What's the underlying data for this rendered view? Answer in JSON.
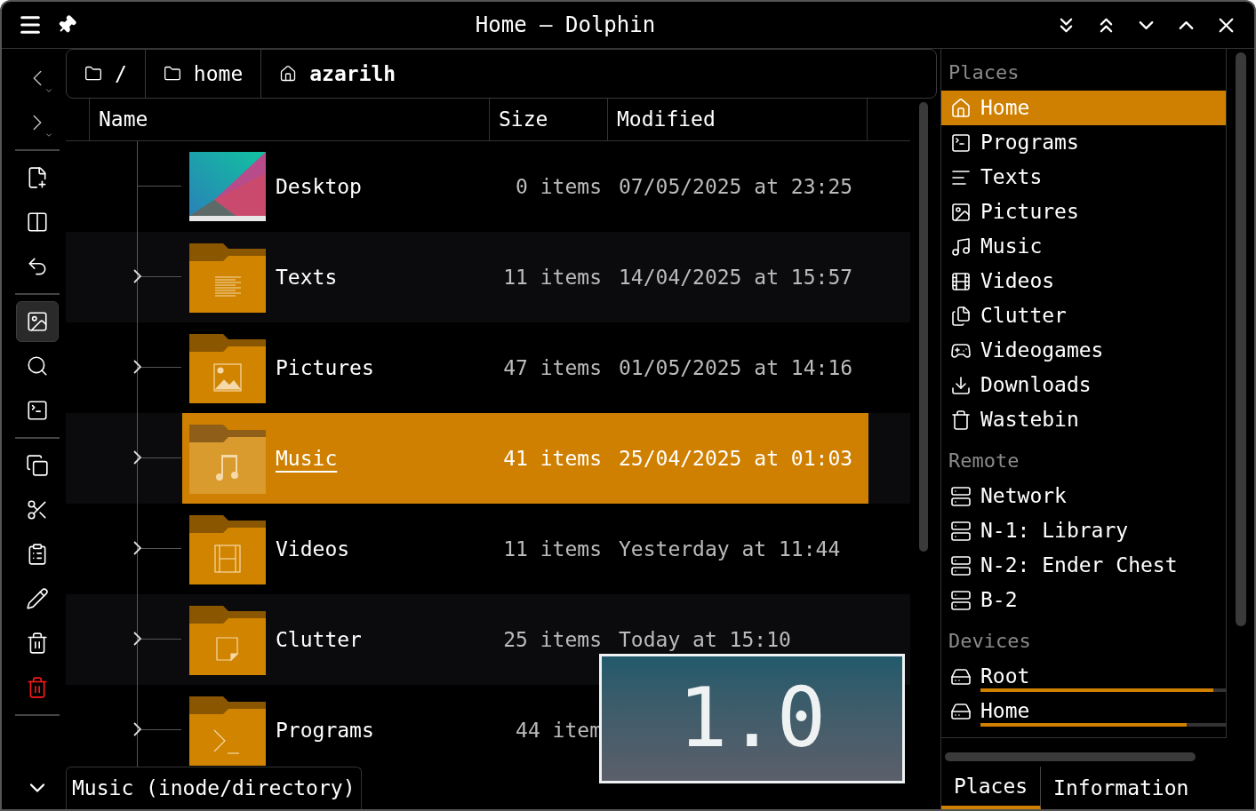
{
  "window": {
    "title": "Home — Dolphin"
  },
  "toolbar": [
    {
      "kind": "back",
      "selected": false
    },
    {
      "kind": "forward",
      "selected": false
    },
    {
      "kind": "separator"
    },
    {
      "kind": "new-file",
      "selected": false
    },
    {
      "kind": "split",
      "selected": false
    },
    {
      "kind": "undo",
      "selected": false
    },
    {
      "kind": "separator"
    },
    {
      "kind": "preview",
      "selected": true
    },
    {
      "kind": "search",
      "selected": false
    },
    {
      "kind": "terminal",
      "selected": false
    },
    {
      "kind": "separator"
    },
    {
      "kind": "copy",
      "selected": false
    },
    {
      "kind": "cut",
      "selected": false
    },
    {
      "kind": "paste",
      "selected": false
    },
    {
      "kind": "rename",
      "selected": false
    },
    {
      "kind": "trash",
      "selected": false
    },
    {
      "kind": "delete",
      "selected": false
    },
    {
      "kind": "separator"
    }
  ],
  "breadcrumb": [
    {
      "kind": "folder",
      "label": "/",
      "selected": false
    },
    {
      "kind": "folder",
      "label": "home",
      "selected": false
    },
    {
      "kind": "home",
      "label": "azarilh",
      "selected": true
    }
  ],
  "columns": [
    "Name",
    "Size",
    "Modified"
  ],
  "rows": [
    {
      "name": "Desktop",
      "kind": "wallpaper",
      "size": "0 items",
      "modified": "07/05/2025 at 23:25",
      "expandable": false,
      "selected": false
    },
    {
      "name": "Texts",
      "kind": "texts",
      "size": "11 items",
      "modified": "14/04/2025 at 15:57",
      "expandable": true,
      "selected": false
    },
    {
      "name": "Pictures",
      "kind": "pictures",
      "size": "47 items",
      "modified": "01/05/2025 at 14:16",
      "expandable": true,
      "selected": false
    },
    {
      "name": "Music",
      "kind": "music",
      "size": "41 items",
      "modified": "25/04/2025 at 01:03",
      "expandable": true,
      "selected": true
    },
    {
      "name": "Videos",
      "kind": "videos",
      "size": "11 items",
      "modified": "Yesterday at 11:44",
      "expandable": true,
      "selected": false
    },
    {
      "name": "Clutter",
      "kind": "clutter",
      "size": "25 items",
      "modified": "Today at 15:10",
      "expandable": true,
      "selected": false
    },
    {
      "name": "Programs",
      "kind": "programs",
      "size": "44 item",
      "expandable": true,
      "selected": false
    }
  ],
  "status_bar": "Music (inode/directory)",
  "places": [
    {
      "title": "Places",
      "items": [
        {
          "label": "Home",
          "kind": "home",
          "selected": true
        },
        {
          "label": "Programs",
          "kind": "programs",
          "selected": false
        },
        {
          "label": "Texts",
          "kind": "texts",
          "selected": false
        },
        {
          "label": "Pictures",
          "kind": "pictures",
          "selected": false
        },
        {
          "label": "Music",
          "kind": "music",
          "selected": false
        },
        {
          "label": "Videos",
          "kind": "videos",
          "selected": false
        },
        {
          "label": "Clutter",
          "kind": "clutter",
          "selected": false
        },
        {
          "label": "Videogames",
          "kind": "games",
          "selected": false
        },
        {
          "label": "Downloads",
          "kind": "downloads",
          "selected": false
        },
        {
          "label": "Wastebin",
          "kind": "wastebin",
          "selected": false
        }
      ]
    },
    {
      "title": "Remote",
      "items": [
        {
          "label": "Network",
          "kind": "network",
          "selected": false
        },
        {
          "label": "N-1: Library",
          "kind": "network",
          "selected": false
        },
        {
          "label": "N-2: Ender Chest",
          "kind": "network",
          "selected": false
        },
        {
          "label": "B-2",
          "kind": "network",
          "selected": false
        }
      ]
    },
    {
      "title": "Devices",
      "items": [
        {
          "label": "Root",
          "kind": "drive",
          "level": 0.95,
          "selected": false
        },
        {
          "label": "Home",
          "kind": "drive",
          "level": 0.84,
          "selected": false
        }
      ]
    }
  ],
  "panel_tabs": [
    {
      "label": "Places",
      "selected": true
    },
    {
      "label": "Information",
      "selected": false
    }
  ],
  "overlay": {
    "text": "1.0"
  }
}
